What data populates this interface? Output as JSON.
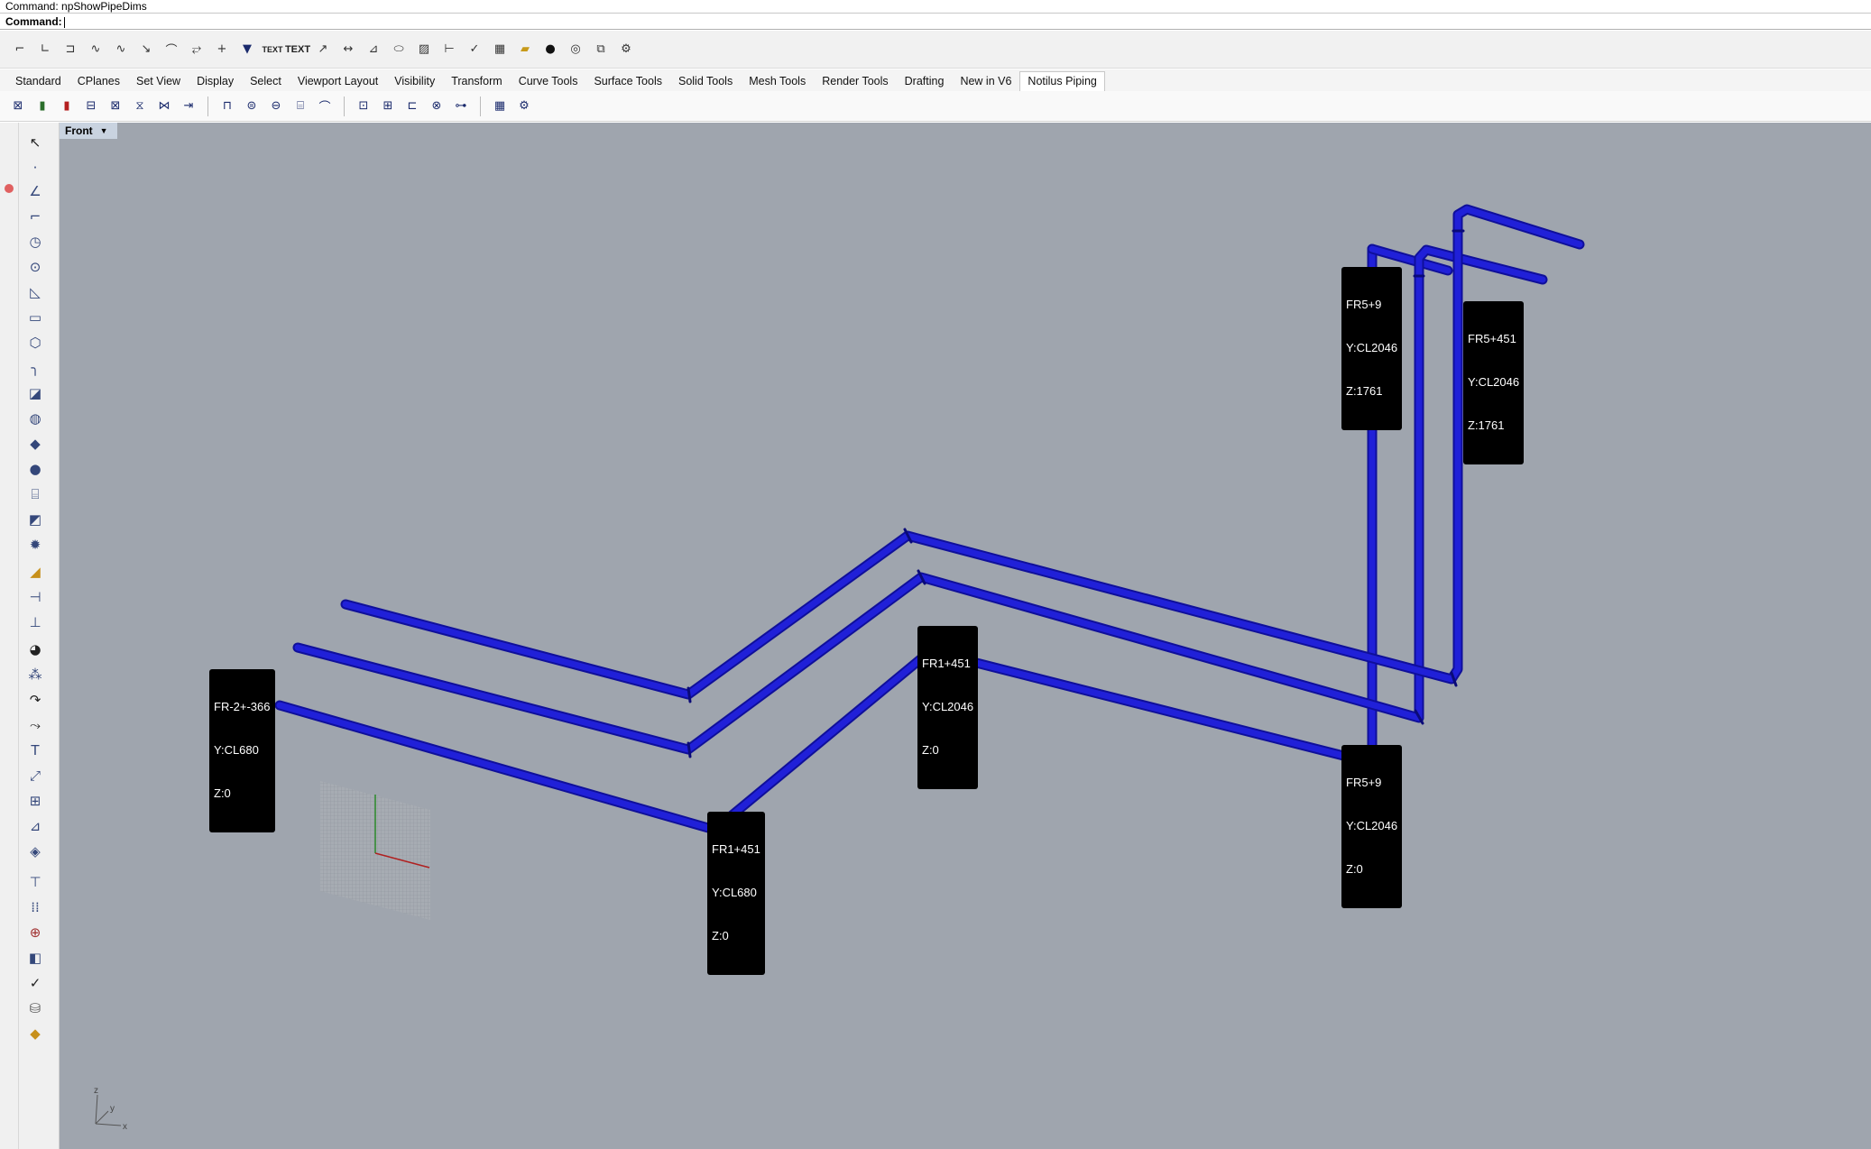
{
  "command": {
    "history": "Command: npShowPipeDims",
    "prompt": "Command:"
  },
  "toolbar_top": {
    "icons": [
      "curve-from-points-icon",
      "polyline-icon",
      "line-icon",
      "curve-icon",
      "interp-curve-icon",
      "sketch-curve-icon",
      "conic-icon",
      "helix-icon",
      "point-icon",
      "dimension-icon",
      "text-icon",
      "text-object-icon",
      "leader-icon",
      "linear-dim-icon",
      "radius-dim-icon",
      "ellipse-icon",
      "hatch-icon",
      "annotation-icon",
      "check-icon",
      "table-icon",
      "folder-icon",
      "sphere-render-icon",
      "snapshot-icon",
      "layout-icon",
      "options-icon"
    ],
    "text_label_small": "TEXT",
    "text_label_large": "TEXT"
  },
  "tabs": [
    {
      "label": "Standard",
      "active": false
    },
    {
      "label": "CPlanes",
      "active": false
    },
    {
      "label": "Set View",
      "active": false
    },
    {
      "label": "Display",
      "active": false
    },
    {
      "label": "Select",
      "active": false
    },
    {
      "label": "Viewport Layout",
      "active": false
    },
    {
      "label": "Visibility",
      "active": false
    },
    {
      "label": "Transform",
      "active": false
    },
    {
      "label": "Curve Tools",
      "active": false
    },
    {
      "label": "Surface Tools",
      "active": false
    },
    {
      "label": "Solid Tools",
      "active": false
    },
    {
      "label": "Mesh Tools",
      "active": false
    },
    {
      "label": "Render Tools",
      "active": false
    },
    {
      "label": "Drafting",
      "active": false
    },
    {
      "label": "New in V6",
      "active": false
    },
    {
      "label": "Notilus Piping",
      "active": true
    }
  ],
  "viewport": {
    "name": "Front",
    "background": "#9fa5ae",
    "pipe_color": "#1c1cdb"
  },
  "pipe_labels": [
    {
      "id": "label-fr-2-366",
      "line1": "FR-2+-366",
      "line2": "Y:CL680",
      "line3": "Z:0"
    },
    {
      "id": "label-fr1-451-cl680",
      "line1": "FR1+451",
      "line2": "Y:CL680",
      "line3": "Z:0"
    },
    {
      "id": "label-fr1-451-cl2046",
      "line1": "FR1+451",
      "line2": "Y:CL2046",
      "line3": "Z:0"
    },
    {
      "id": "label-fr5-9-bottom",
      "line1": "FR5+9",
      "line2": "Y:CL2046",
      "line3": "Z:0"
    },
    {
      "id": "label-fr5-9-top",
      "line1": "FR5+9",
      "line2": "Y:CL2046",
      "line3": "Z:1761"
    },
    {
      "id": "label-fr5-451-top",
      "line1": "FR5+451",
      "line2": "Y:CL2046",
      "line3": "Z:1761"
    }
  ],
  "axes_indicator": {
    "z": "z",
    "y": "y",
    "x": "x"
  }
}
